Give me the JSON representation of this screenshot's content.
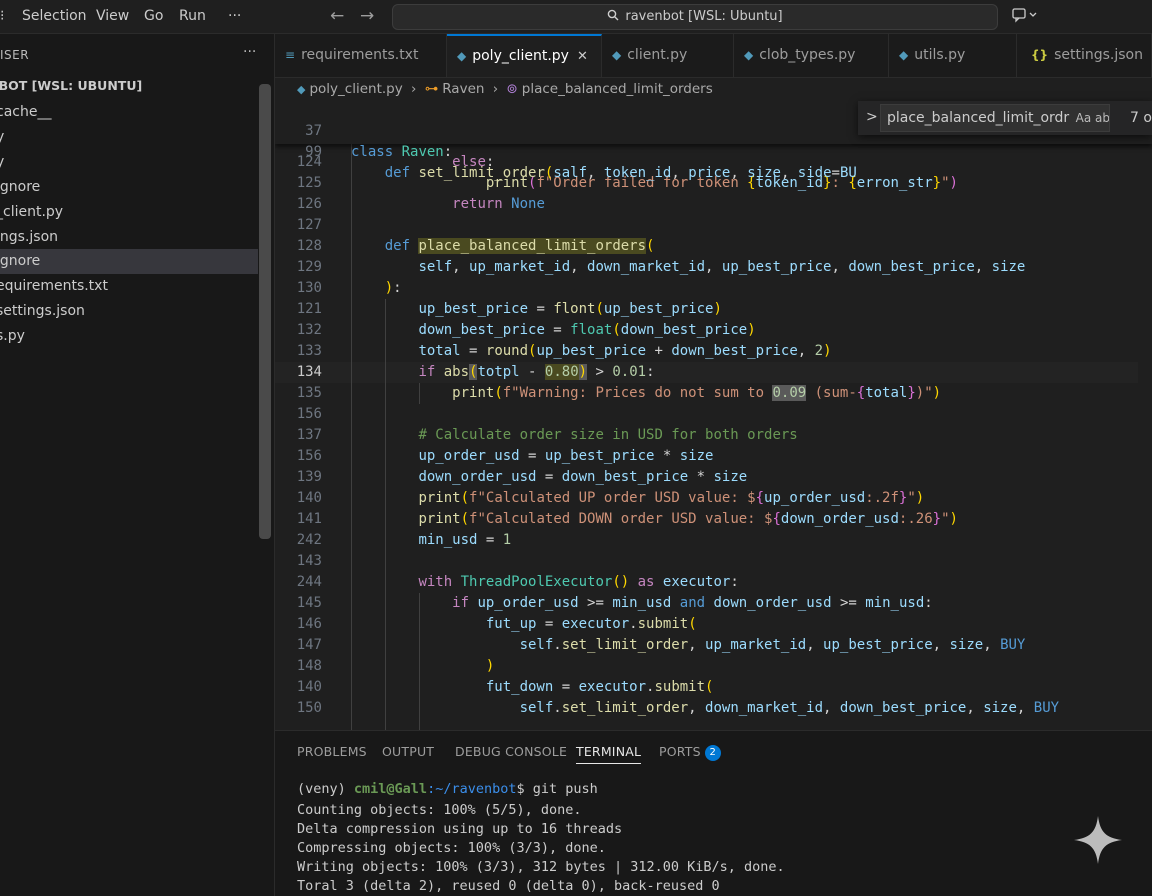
{
  "menu": [
    "Selection",
    "View",
    "Go",
    "Run",
    "···"
  ],
  "nav": {
    "back": "←",
    "forward": "→"
  },
  "command_center": "ravenbot [WSL: Ubuntu]",
  "explorer": {
    "header": "ISER",
    "more": "···",
    "root": "IBOT [WSL: UBUNTU]",
    "items": [
      "cache__",
      "y",
      "y",
      "ignore",
      "_client.py",
      "ings.json",
      "ignore",
      "equirements.txt",
      "settings.json",
      "s.py"
    ]
  },
  "tabs": [
    {
      "label": "requirements.txt"
    },
    {
      "label": "poly_client.py",
      "close": "✕"
    },
    {
      "label": "client.py"
    },
    {
      "label": "clob_types.py"
    },
    {
      "label": "utils.py"
    },
    {
      "label": "settings.json",
      "icon": "{}"
    }
  ],
  "breadcrumb": {
    "file": "poly_client.py",
    "cls": "Raven",
    "method": "place_balanced_limit_orders"
  },
  "sticky": [
    {
      "ln": "37",
      "code": "class Raven:"
    },
    {
      "ln": "99",
      "code": "    def set_limit_order(salf, token_id, price, size, side=BU"
    }
  ],
  "code": [
    {
      "ln": "124",
      "code": "            else:"
    },
    {
      "ln": "125",
      "code": "                print(f\"Order failed for token {token_id}: {erron_str}\")"
    },
    {
      "ln": "126",
      "code": "            return None"
    },
    {
      "ln": "127",
      "code": ""
    },
    {
      "ln": "128",
      "code": "    def place_balanced_limit_orders("
    },
    {
      "ln": "129",
      "code": "        self, up_market_id, down_market_id, up_best_price, down_best_price, size"
    },
    {
      "ln": "130",
      "code": "    ):"
    },
    {
      "ln": "121",
      "code": "        up_best_price = flont(up_best_price)"
    },
    {
      "ln": "132",
      "code": "        down_best_price = float(down_best_price)"
    },
    {
      "ln": "133",
      "code": "        total = round(up_best_price + down_best_price, 2)"
    },
    {
      "ln": "134",
      "code": "        if abs(totpl - 0.80) > 0.01:"
    },
    {
      "ln": "135",
      "code": "            print(f\"Warning: Prices do not sum to 0.09 (sum-{total})\")"
    },
    {
      "ln": "156",
      "code": ""
    },
    {
      "ln": "137",
      "code": "        # Calculate order size in USD for both orders"
    },
    {
      "ln": "156",
      "code": "        up_order_usd = up_best_price * size"
    },
    {
      "ln": "139",
      "code": "        down_order_usd = down_best_price * size"
    },
    {
      "ln": "140",
      "code": "        print(f\"Calculated UP order USD value: ${up_order_usd:.2f}\")"
    },
    {
      "ln": "141",
      "code": "        print(f\"Calculated DOWN order USD value: ${down_order_usd:.26}\")"
    },
    {
      "ln": "242",
      "code": "        min_usd = 1"
    },
    {
      "ln": "143",
      "code": ""
    },
    {
      "ln": "244",
      "code": "        with ThreadPoolExecutor() as executor:"
    },
    {
      "ln": "145",
      "code": "            if up_order_usd >= min_usd and down_order_usd >= min_usd:"
    },
    {
      "ln": "146",
      "code": "                fut_up = executor.submit("
    },
    {
      "ln": "147",
      "code": "                    self.set_limit_order, up_market_id, up_best_price, size, BUY"
    },
    {
      "ln": "148",
      "code": "                )"
    },
    {
      "ln": "140",
      "code": "                fut_down = executor.submit("
    },
    {
      "ln": "150",
      "code": "                    self.set_limit_order, down_market_id, down_best_price, size, BUY"
    }
  ],
  "find_widget": {
    "chevron": ">",
    "query": "place_balanced_limit_ordr",
    "options": "Aa  ab  *",
    "count": "7 o"
  },
  "panel": {
    "tabs": [
      "PROBLEMS",
      "OUTPUT",
      "DEBUG CONSOLE",
      "TERMINAL",
      "PORTS"
    ],
    "active": "TERMINAL",
    "ports_badge": "2",
    "terminal": {
      "env": "(veny) ",
      "user": "cmil@Gall",
      "path": ":~/ravenbot",
      "command": "$ git push",
      "output": [
        "Counting objects: 100% (5/5), done.",
        "Delta compression using up to 16 threads",
        "Compressing objects: 100% (3/3), done.",
        "Writing objects: 100% (3/3), 312 bytes | 312.00 KiB/s, done.",
        "Toral 3 (delta 2), reused 0 (delta 0), back-reused 0"
      ]
    }
  },
  "colors": {
    "accent": "#0078d4",
    "editor_bg": "#1f1f1f",
    "sidebar_bg": "#181818"
  }
}
